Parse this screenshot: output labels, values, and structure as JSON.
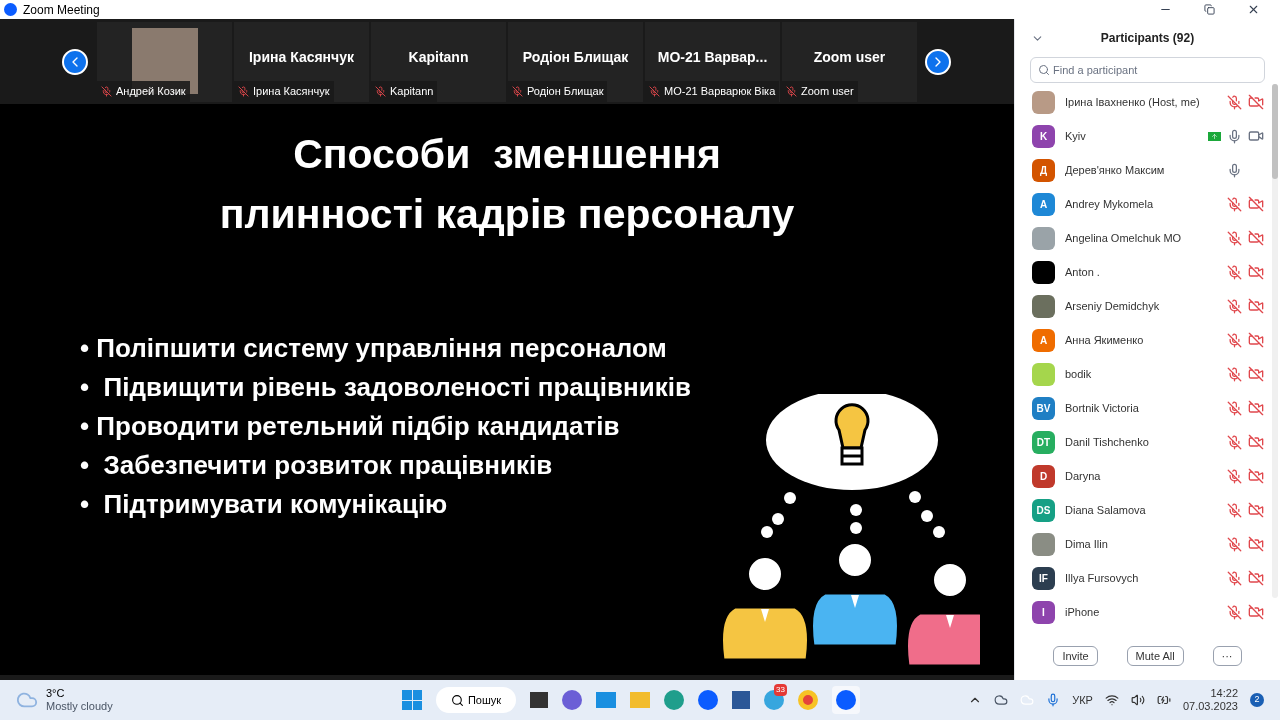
{
  "window": {
    "title": "Zoom Meeting"
  },
  "video_strip": [
    {
      "kind": "photo",
      "label": "Андрей Козик"
    },
    {
      "kind": "name",
      "name": "Ірина Касянчук",
      "label": "Ірина Касянчук"
    },
    {
      "kind": "name",
      "name": "Kapitann",
      "label": "Kapitann"
    },
    {
      "kind": "name",
      "name": "Родіон Блищак",
      "label": "Родіон Блищак"
    },
    {
      "kind": "name",
      "name": "МО-21  Варвар...",
      "label": "МО-21 Варварюк Віка"
    },
    {
      "kind": "name",
      "name": "Zoom user",
      "label": "Zoom user"
    }
  ],
  "slide": {
    "title": [
      "Способи  зменшення",
      "плинності кадрів персоналу"
    ],
    "bullets": [
      "• Поліпшити систему управління персоналом",
      "•  Підвищити рівень задоволеності працівників",
      "• Проводити ретельний підбір кандидатів",
      "•  Забезпечити розвиток працівників",
      "•  Підтримувати комунікацію"
    ]
  },
  "participants_panel": {
    "title": "Participants (92)",
    "search": {
      "placeholder": "Find a participant"
    },
    "participants": [
      {
        "name": "Ірина Івахненко (Host, me)",
        "kind": "photo",
        "color": "#b89a86",
        "muted": true,
        "camera": true,
        "camera_off": true,
        "sharing": false
      },
      {
        "name": "Kyiv",
        "kind": "initials",
        "initials": "K",
        "color": "#8e44ad",
        "muted": false,
        "camera": true,
        "camera_off": false,
        "sharing": true
      },
      {
        "name": "Дерев'янко Максим",
        "kind": "initials",
        "initials": "Д",
        "color": "#d35400",
        "muted": false,
        "camera": false,
        "sharing": false
      },
      {
        "name": "Andrey Mykomela",
        "kind": "initials",
        "initials": "A",
        "color": "#1e88d6",
        "muted": true,
        "camera": true,
        "camera_off": true,
        "sharing": false
      },
      {
        "name": "Angelina Omelchuk MO",
        "kind": "photo",
        "color": "#9aa3a8",
        "muted": true,
        "camera": true,
        "camera_off": true,
        "sharing": false
      },
      {
        "name": "Anton .",
        "kind": "photo",
        "color": "#000000",
        "muted": true,
        "camera": true,
        "camera_off": true,
        "sharing": false
      },
      {
        "name": "Arseniy Demidchyk",
        "kind": "photo",
        "color": "#6b6f5e",
        "muted": true,
        "camera": true,
        "camera_off": true,
        "sharing": false
      },
      {
        "name": "Анна Якименко",
        "kind": "initials",
        "initials": "A",
        "color": "#ef6c00",
        "muted": true,
        "camera": true,
        "camera_off": true,
        "sharing": false
      },
      {
        "name": "bodik",
        "kind": "photo",
        "color": "#a5d64c",
        "muted": true,
        "camera": true,
        "camera_off": true,
        "sharing": false
      },
      {
        "name": "Bortnik Victoria",
        "kind": "initials",
        "initials": "BV",
        "color": "#1f7fc4",
        "muted": true,
        "camera": true,
        "camera_off": true,
        "sharing": false
      },
      {
        "name": "Danil Tishchenko",
        "kind": "initials",
        "initials": "DT",
        "color": "#27ae60",
        "muted": true,
        "camera": true,
        "camera_off": true,
        "sharing": false
      },
      {
        "name": "Daryna",
        "kind": "initials",
        "initials": "D",
        "color": "#c0392b",
        "muted": true,
        "camera": true,
        "camera_off": true,
        "sharing": false
      },
      {
        "name": "Diana Salamova",
        "kind": "initials",
        "initials": "DS",
        "color": "#16a085",
        "muted": true,
        "camera": true,
        "camera_off": true,
        "sharing": false
      },
      {
        "name": "Dima Ilin",
        "kind": "photo",
        "color": "#8a8d84",
        "muted": true,
        "camera": true,
        "camera_off": true,
        "sharing": false
      },
      {
        "name": "Illya Fursovych",
        "kind": "initials",
        "initials": "IF",
        "color": "#2c3e50",
        "muted": true,
        "camera": true,
        "camera_off": true,
        "sharing": false
      },
      {
        "name": "iPhone",
        "kind": "initials",
        "initials": "I",
        "color": "#8e44ad",
        "muted": true,
        "camera": true,
        "camera_off": true,
        "sharing": false
      }
    ],
    "buttons": [
      "Invite",
      "Mute All",
      "···"
    ]
  },
  "taskbar": {
    "weather": {
      "temperature": "3°C",
      "condition": "Mostly cloudy"
    },
    "search": "Пошук",
    "telegram_badge": "33",
    "language": "УКР",
    "time": "14:22",
    "date": "07.03.2023",
    "notifications": "2"
  }
}
